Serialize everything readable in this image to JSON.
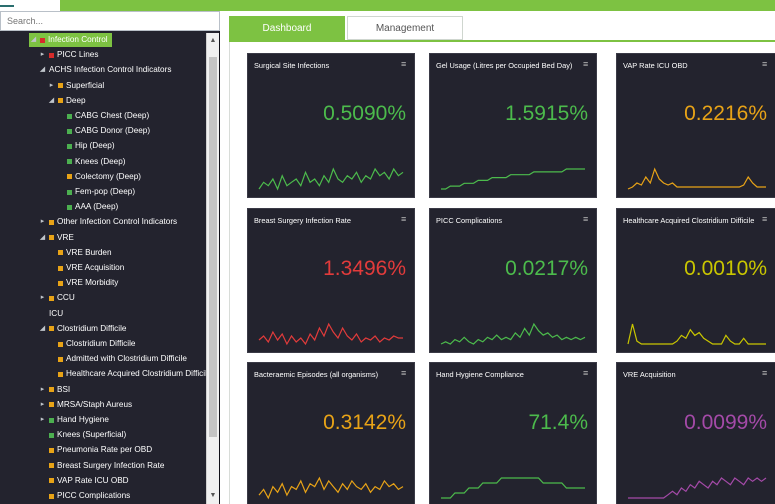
{
  "search": {
    "placeholder": "Search..."
  },
  "tree": [
    {
      "label": "Infection Control",
      "color": "#d62b2b",
      "arrow": "◢",
      "selected": true
    },
    {
      "label": "PICC Lines",
      "color": "#d62b2b",
      "arrow": "▸"
    },
    {
      "label": "ACHS Infection Control Indicators",
      "color": "",
      "arrow": "◢"
    },
    {
      "label": "Superficial",
      "color": "#e8a317",
      "arrow": "▸"
    },
    {
      "label": "Deep",
      "color": "#e8a317",
      "arrow": "◢"
    },
    {
      "label": "CABG Chest (Deep)",
      "color": "#4caf50",
      "arrow": ""
    },
    {
      "label": "CABG Donor (Deep)",
      "color": "#4caf50",
      "arrow": ""
    },
    {
      "label": "Hip (Deep)",
      "color": "#4caf50",
      "arrow": ""
    },
    {
      "label": "Knees (Deep)",
      "color": "#4caf50",
      "arrow": ""
    },
    {
      "label": "Colectomy (Deep)",
      "color": "#e8a317",
      "arrow": ""
    },
    {
      "label": "Fem-pop (Deep)",
      "color": "#4caf50",
      "arrow": ""
    },
    {
      "label": "AAA (Deep)",
      "color": "#4caf50",
      "arrow": ""
    },
    {
      "label": "Other Infection Control Indicators",
      "color": "#e8a317",
      "arrow": "▸"
    },
    {
      "label": "VRE",
      "color": "#e8a317",
      "arrow": "◢"
    },
    {
      "label": "VRE Burden",
      "color": "#e8a317",
      "arrow": ""
    },
    {
      "label": "VRE Acquisition",
      "color": "#e8a317",
      "arrow": ""
    },
    {
      "label": "VRE Morbidity",
      "color": "#e8a317",
      "arrow": ""
    },
    {
      "label": "CCU",
      "color": "#e8a317",
      "arrow": "▸"
    },
    {
      "label": "ICU",
      "color": "",
      "arrow": ""
    },
    {
      "label": "Clostridium Difficile",
      "color": "#e8a317",
      "arrow": "◢"
    },
    {
      "label": "Clostridium Difficile",
      "color": "#e8a317",
      "arrow": ""
    },
    {
      "label": "Admitted with Clostridium Difficile",
      "color": "#e8a317",
      "arrow": ""
    },
    {
      "label": "Healthcare Acquired Clostridium Difficile",
      "color": "#e8a317",
      "arrow": ""
    },
    {
      "label": "BSI",
      "color": "#e8a317",
      "arrow": "▸"
    },
    {
      "label": "MRSA/Staph Aureus",
      "color": "#e8a317",
      "arrow": "▸"
    },
    {
      "label": "Hand Hygiene",
      "color": "#4caf50",
      "arrow": "▸"
    },
    {
      "label": "Knees (Superficial)",
      "color": "#4caf50",
      "arrow": ""
    },
    {
      "label": "Pneumonia Rate per OBD",
      "color": "#e8a317",
      "arrow": ""
    },
    {
      "label": "Breast Surgery Infection Rate",
      "color": "#e8a317",
      "arrow": ""
    },
    {
      "label": "VAP Rate ICU OBD",
      "color": "#e8a317",
      "arrow": ""
    },
    {
      "label": "PICC Complications",
      "color": "#e8a317",
      "arrow": ""
    }
  ],
  "tabs": [
    {
      "label": "Dashboard",
      "active": true
    },
    {
      "label": "Management",
      "active": false
    }
  ],
  "cards": [
    {
      "title": "Surgical Site Infections",
      "value": "0.5090%",
      "color": "#4cbb4c",
      "trend": [
        3,
        5,
        4,
        6,
        3,
        7,
        4,
        5,
        6,
        4,
        8,
        5,
        6,
        4,
        7,
        5,
        9,
        6,
        5,
        7,
        6,
        8,
        5,
        7,
        6,
        9,
        7,
        8,
        6,
        9,
        7,
        8
      ]
    },
    {
      "title": "Gel Usage (Litres per Occupied Bed Day)",
      "value": "1.5915%",
      "color": "#4cbb4c",
      "trend": [
        2,
        2,
        3,
        3,
        3,
        4,
        4,
        4,
        5,
        5,
        5,
        6,
        6,
        6,
        6,
        7,
        7,
        7,
        7,
        7,
        8,
        8,
        8,
        8,
        8,
        8,
        8,
        9,
        9,
        9,
        9,
        9
      ]
    },
    {
      "title": "VAP Rate ICU OBD",
      "value": "0.2216%",
      "color": "#e8a317",
      "trend": [
        2,
        3,
        5,
        4,
        8,
        5,
        12,
        7,
        5,
        4,
        5,
        3,
        3,
        3,
        3,
        3,
        3,
        3,
        3,
        3,
        3,
        3,
        3,
        3,
        3,
        3,
        4,
        8,
        5,
        3,
        3,
        3
      ]
    },
    {
      "title": "Breast Surgery Infection Rate",
      "value": "1.3496%",
      "color": "#e23b3b",
      "trend": [
        6,
        8,
        5,
        10,
        6,
        9,
        4,
        8,
        5,
        7,
        4,
        9,
        6,
        12,
        8,
        14,
        10,
        7,
        12,
        8,
        6,
        9,
        5,
        7,
        6,
        8,
        5,
        7,
        6,
        8,
        7,
        7
      ]
    },
    {
      "title": "PICC Complications",
      "value": "0.0217%",
      "color": "#4cbb4c",
      "trend": [
        3,
        4,
        3,
        5,
        4,
        6,
        4,
        3,
        5,
        4,
        6,
        5,
        7,
        5,
        6,
        5,
        8,
        6,
        10,
        7,
        12,
        9,
        7,
        8,
        6,
        7,
        5,
        6,
        5,
        6,
        5,
        6
      ]
    },
    {
      "title": "Healthcare Acquired Clostridium Difficile",
      "value": "0.0010%",
      "color": "#c9c600",
      "trend": [
        3,
        10,
        4,
        3,
        3,
        3,
        3,
        3,
        3,
        3,
        3,
        4,
        6,
        5,
        8,
        6,
        7,
        5,
        4,
        3,
        3,
        3,
        6,
        4,
        3,
        3,
        5,
        3,
        3,
        3,
        3,
        3
      ]
    },
    {
      "title": "Bacteraemic Episodes (all organisms)",
      "value": "0.3142%",
      "color": "#e8a317",
      "trend": [
        5,
        7,
        4,
        8,
        6,
        9,
        5,
        8,
        7,
        10,
        6,
        9,
        8,
        11,
        7,
        10,
        8,
        6,
        9,
        7,
        10,
        8,
        7,
        9,
        6,
        8,
        7,
        10,
        8,
        9,
        7,
        8
      ]
    },
    {
      "title": "Hand Hygiene Compliance",
      "value": "71.4%",
      "color": "#4cbb4c",
      "trend": [
        4,
        4,
        4,
        5,
        5,
        5,
        6,
        6,
        6,
        7,
        7,
        7,
        7,
        8,
        8,
        8,
        8,
        8,
        8,
        8,
        8,
        8,
        7,
        7,
        7,
        7,
        7,
        6,
        6,
        6,
        6,
        6
      ]
    },
    {
      "title": "VRE Acquisition",
      "value": "0.0099%",
      "color": "#a44aa8",
      "trend": [
        3,
        3,
        3,
        3,
        3,
        3,
        3,
        3,
        3,
        4,
        5,
        4,
        6,
        5,
        7,
        6,
        8,
        7,
        6,
        8,
        7,
        9,
        8,
        7,
        9,
        8,
        7,
        9,
        8,
        9,
        8,
        9
      ]
    }
  ]
}
